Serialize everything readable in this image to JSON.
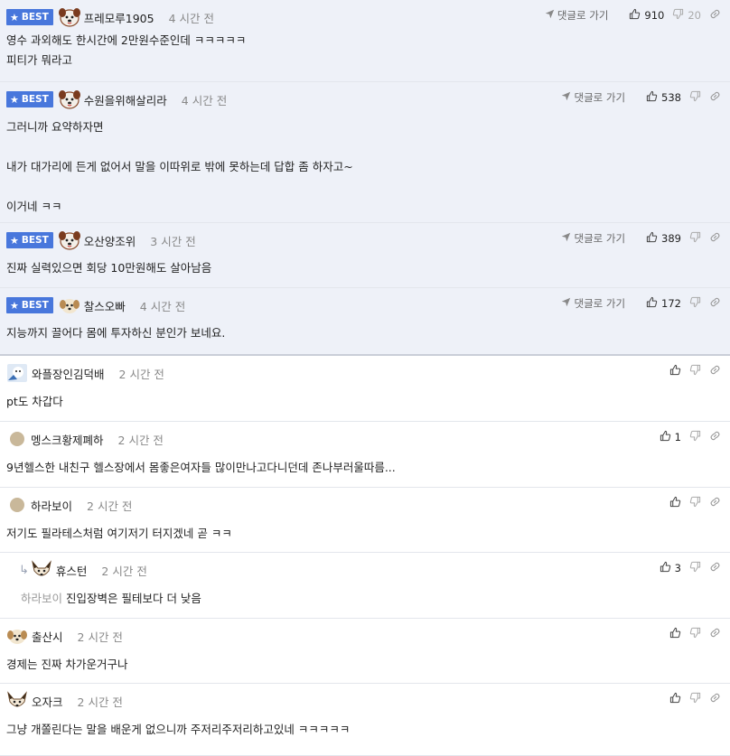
{
  "labels": {
    "best": "BEST",
    "reply": "댓글로 가기"
  },
  "colors": {
    "badge": "#4877dc",
    "best_bg": "#eef1f8"
  },
  "comments": [
    {
      "best": true,
      "avatar": "dog-face",
      "nick": "프레모루1905",
      "time": "4 시간 전",
      "up": "910",
      "down": "20",
      "text": "영수 과외해도 한시간에 2만원수준인데 ㅋㅋㅋㅋㅋ\n피티가 뭐라고",
      "h": 91,
      "bodyTop": 34
    },
    {
      "best": true,
      "avatar": "dog-face",
      "nick": "수원을위해살리라",
      "time": "4 시간 전",
      "up": "538",
      "down": "",
      "text": "그러니까 요약하자면\n\n내가 대가리에 든게 없어서 말을 이따위로 밖에 못하는데 답합 좀 하자고~\n\n이거네 ㅋㅋ",
      "h": 156,
      "bodyTop": 39
    },
    {
      "best": true,
      "avatar": "dog-face",
      "nick": "오산양조위",
      "time": "3 시간 전",
      "up": "389",
      "down": "",
      "text": "진짜 실력있으면 회당 10만원해도 살아남음",
      "h": 72,
      "bodyTop": 39
    },
    {
      "best": true,
      "avatar": "puppy",
      "nick": "찰스오빠",
      "time": "4 시간 전",
      "up": "172",
      "down": "",
      "text": "지능까지 끌어다 몸에 투자하신 분인가 보네요.",
      "h": 75,
      "bodyTop": 39
    },
    {
      "best": false,
      "avatar": "photo",
      "nick": "와플장인김덕배",
      "time": "2 시간 전",
      "up": "",
      "down": "",
      "text": "pt도 차갑다",
      "h": 73,
      "bodyTop": 40
    },
    {
      "best": false,
      "avatar": "dot",
      "nick": "멩스크황제폐하",
      "time": "2 시간 전",
      "up": "1",
      "down": "",
      "text": "9년헬스한 내친구 헬스장에서 몸좋은여자들 많이만나고다니던데 존나부러울따름...",
      "h": 73,
      "bodyTop": 40
    },
    {
      "best": false,
      "avatar": "dot",
      "nick": "하라보이",
      "time": "2 시간 전",
      "up": "",
      "down": "",
      "text": "저기도 필라테스처럼 여기저기 터지겠네 곧 ㅋㅋ",
      "h": 72,
      "bodyTop": 40
    },
    {
      "best": false,
      "reply": true,
      "avatar": "fox",
      "nick": "휴스턴",
      "time": "2 시간 전",
      "up": "3",
      "down": "",
      "mention": "하라보이",
      "text": "진입장벽은 필테보다 더 낮음",
      "h": 73,
      "bodyTop": 40
    },
    {
      "best": false,
      "avatar": "puppy",
      "nick": "출산시",
      "time": "2 시간 전",
      "up": "",
      "down": "",
      "text": "경제는 진짜 차가운거구나",
      "h": 72,
      "bodyTop": 40
    },
    {
      "best": false,
      "avatar": "fox",
      "nick": "오자크",
      "time": "2 시간 전",
      "up": "",
      "down": "",
      "text": "그냥 개쫄린다는 말을 배운게 없으니까 주저리주저리하고있네 ㅋㅋㅋㅋㅋ",
      "h": 80,
      "bodyTop": 40
    }
  ]
}
